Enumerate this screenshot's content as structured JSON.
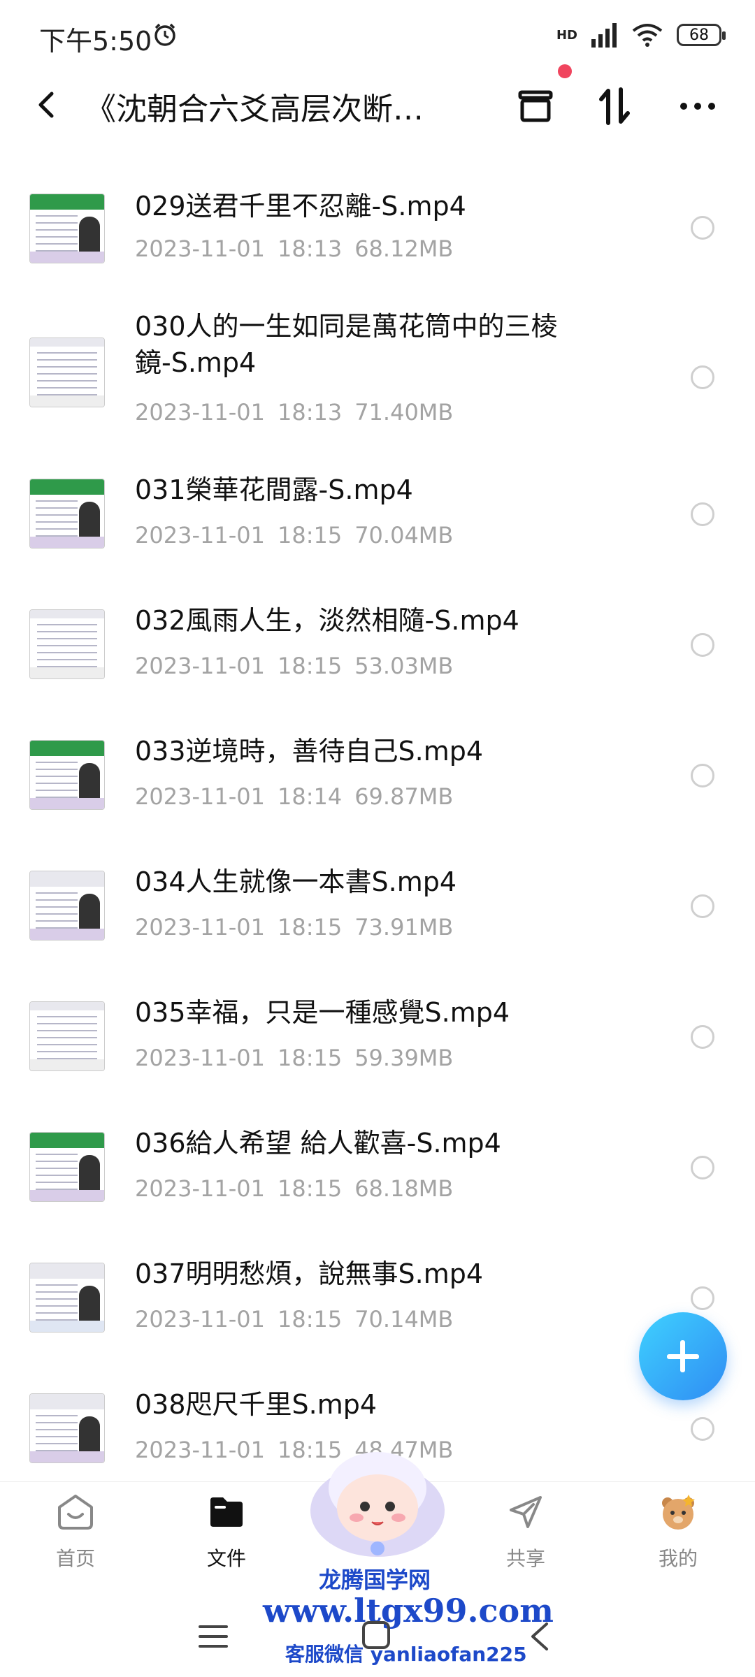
{
  "status_bar": {
    "time": "下午5:50",
    "network": "HD",
    "battery": "68"
  },
  "header": {
    "title": "《沈朝合六爻高层次断…"
  },
  "files": [
    {
      "name": "029送君千里不忍離-S.mp4",
      "date": "2023-11-01",
      "time": "18:13",
      "size": "68.12MB"
    },
    {
      "name": "030人的一生如同是萬花筒中的三棱鏡-S.mp4",
      "date": "2023-11-01",
      "time": "18:13",
      "size": "71.40MB"
    },
    {
      "name": "031榮華花間露-S.mp4",
      "date": "2023-11-01",
      "time": "18:15",
      "size": "70.04MB"
    },
    {
      "name": "032風雨人生，淡然相隨-S.mp4",
      "date": "2023-11-01",
      "time": "18:15",
      "size": "53.03MB"
    },
    {
      "name": "033逆境時，善待自己S.mp4",
      "date": "2023-11-01",
      "time": "18:14",
      "size": "69.87MB"
    },
    {
      "name": "034人生就像一本書S.mp4",
      "date": "2023-11-01",
      "time": "18:15",
      "size": "73.91MB"
    },
    {
      "name": "035幸福，只是一種感覺S.mp4",
      "date": "2023-11-01",
      "time": "18:15",
      "size": "59.39MB"
    },
    {
      "name": "036給人希望 給人歡喜-S.mp4",
      "date": "2023-11-01",
      "time": "18:15",
      "size": "68.18MB"
    },
    {
      "name": "037明明愁煩，說無事S.mp4",
      "date": "2023-11-01",
      "time": "18:15",
      "size": "70.14MB"
    },
    {
      "name": "038咫尺千里S.mp4",
      "date": "2023-11-01",
      "time": "18:15",
      "size": "48.47MB"
    }
  ],
  "nav": {
    "home": "首页",
    "files": "文件",
    "share": "共享",
    "me": "我的"
  },
  "watermark": {
    "line1": "龙腾国学网",
    "line2": "www.ltgx99.com",
    "line3": "客服微信 yanliaofan225"
  },
  "colors": {
    "accent": "#2f8cf3",
    "badge": "#f0455e",
    "secondary_text": "#a3a3a3"
  }
}
